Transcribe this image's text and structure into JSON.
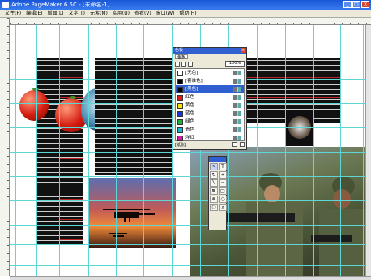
{
  "window": {
    "title": "Adobe PageMaker 6.5C - [未命名-1]",
    "controls": [
      "_",
      "□",
      "×"
    ]
  },
  "menubar": {
    "items": [
      "文件(F)",
      "编辑(E)",
      "版面(L)",
      "文字(T)",
      "元素(M)",
      "实用(U)",
      "查看(V)",
      "窗口(W)",
      "帮助(H)"
    ]
  },
  "swatches_panel": {
    "title": "色板",
    "tabs": [
      "色板"
    ],
    "tint_value": "100%",
    "items": [
      {
        "label": "[无色]",
        "color": "#ffffff",
        "selected": false
      },
      {
        "label": "[套准色]",
        "color": "#000000",
        "selected": false
      },
      {
        "label": "[黑色]",
        "color": "#000000",
        "selected": true
      },
      {
        "label": "红色",
        "color": "#e01818",
        "selected": false
      },
      {
        "label": "黄色",
        "color": "#f4e400",
        "selected": false
      },
      {
        "label": "蓝色",
        "color": "#1833d8",
        "selected": false
      },
      {
        "label": "绿色",
        "color": "#19b23a",
        "selected": false
      },
      {
        "label": "青色",
        "color": "#17b7d0",
        "selected": false
      },
      {
        "label": "洋红",
        "color": "#d31aa6",
        "selected": false
      }
    ],
    "footer_label": "[纸张]"
  },
  "toolbox": {
    "title": "工具",
    "tools": [
      {
        "name": "pointer-tool",
        "glyph": "↖"
      },
      {
        "name": "text-tool",
        "glyph": "T"
      },
      {
        "name": "rotate-tool",
        "glyph": "↻"
      },
      {
        "name": "crop-tool",
        "glyph": "⌗"
      },
      {
        "name": "line-tool",
        "glyph": "╲"
      },
      {
        "name": "constrained-line-tool",
        "glyph": "─"
      },
      {
        "name": "rectangle-frame-tool",
        "glyph": "⊠"
      },
      {
        "name": "rectangle-tool",
        "glyph": "□"
      },
      {
        "name": "ellipse-frame-tool",
        "glyph": "⊗"
      },
      {
        "name": "ellipse-tool",
        "glyph": "○"
      },
      {
        "name": "polygon-tool",
        "glyph": "⬡"
      },
      {
        "name": "zoom-tool",
        "glyph": "⌕"
      }
    ]
  },
  "colors": {
    "guide": "#5fd6d6",
    "column_rule": "#e03030",
    "title_bar": "#1a56d6",
    "panel_bg": "#ece9d8"
  }
}
